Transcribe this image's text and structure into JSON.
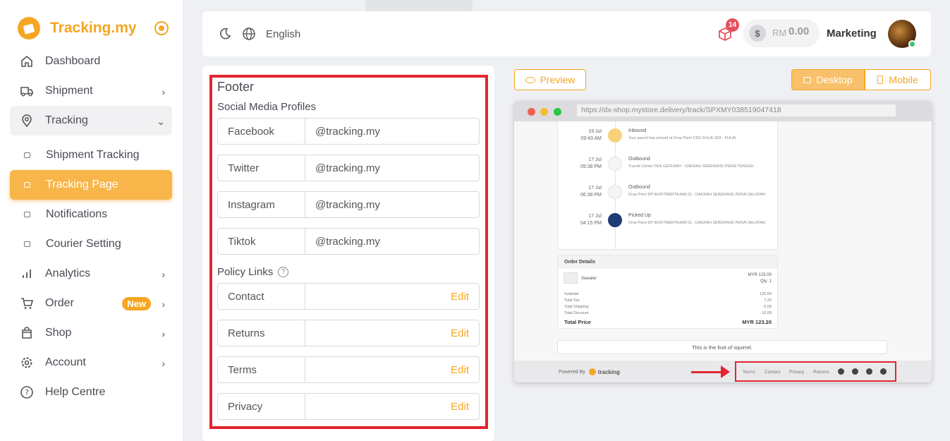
{
  "brand": {
    "name": "Tracking.my",
    "color": "#f5a623"
  },
  "sidebar": {
    "items": [
      {
        "label": "Dashboard",
        "icon": "home-icon"
      },
      {
        "label": "Shipment",
        "icon": "truck-icon",
        "has_chevron": true
      },
      {
        "label": "Tracking",
        "icon": "location-pin-icon",
        "has_chevron": true,
        "expanded": true
      },
      {
        "label": "Analytics",
        "icon": "bar-chart-icon",
        "has_chevron": true
      },
      {
        "label": "Order",
        "icon": "cart-icon",
        "has_chevron": true,
        "badge": "New"
      },
      {
        "label": "Shop",
        "icon": "shopping-bag-icon",
        "has_chevron": true
      },
      {
        "label": "Account",
        "icon": "gear-icon",
        "has_chevron": true
      },
      {
        "label": "Help Centre",
        "icon": "help-circle-icon"
      }
    ],
    "tracking_sub": [
      {
        "label": "Shipment Tracking",
        "active": false
      },
      {
        "label": "Tracking Page",
        "active": true
      },
      {
        "label": "Notifications",
        "active": false
      },
      {
        "label": "Courier Setting",
        "active": false
      }
    ]
  },
  "topbar": {
    "language": "English",
    "notification_count": "14",
    "currency": "RM",
    "balance": "0.00",
    "user_name": "Marketing"
  },
  "footer_settings": {
    "title": "Footer",
    "social_heading": "Social Media Profiles",
    "social": [
      {
        "label": "Facebook",
        "value": "@tracking.my"
      },
      {
        "label": "Twitter",
        "value": "@tracking.my"
      },
      {
        "label": "Instagram",
        "value": "@tracking.my"
      },
      {
        "label": "Tiktok",
        "value": "@tracking.my"
      }
    ],
    "policy_heading": "Policy Links",
    "policies": [
      {
        "label": "Contact",
        "action": "Edit"
      },
      {
        "label": "Returns",
        "action": "Edit"
      },
      {
        "label": "Terms",
        "action": "Edit"
      },
      {
        "label": "Privacy",
        "action": "Edit"
      }
    ]
  },
  "preview": {
    "preview_label": "Preview",
    "desktop_label": "Desktop",
    "mobile_label": "Mobile",
    "url": "https://dx-shop.mystore.delivery/track/SPXMY038519047418",
    "timeline": [
      {
        "date": "19 Jul",
        "time": "09:43 AM",
        "status": "Inbound",
        "desc": "Your parcel has arrived at Drop Point CDC KULAI 303 - KULAI"
      },
      {
        "date": "17 Jul",
        "time": "09:38 PM",
        "status": "Outbound",
        "desc": "Transit Center PEN GATEWAY - DAERAH SEBERANG PERAI TENGAH"
      },
      {
        "date": "17 Jul",
        "time": "06:38 PM",
        "status": "Outbound",
        "desc": "Drop Point DP BUKITMERTAJAM 01 - DAERAH SEBERANG PERAI SELATAN"
      },
      {
        "date": "17 Jul",
        "time": "04:15 PM",
        "status": "Picked Up",
        "desc": "Drop Point DP BUKITMERTAJAM 01 - DAERAH SEBERANG PERAI SELATAN"
      }
    ],
    "order": {
      "title": "Order Details",
      "item": "Sweater",
      "price": "MYR 125.00",
      "qty": "Qty: 1",
      "rows": [
        {
          "label": "Subtotal",
          "value": "120.00"
        },
        {
          "label": "Total Tax",
          "value": "7.20"
        },
        {
          "label": "Total Shipping",
          "value": "6.00"
        },
        {
          "label": "Total Discount",
          "value": "- 10.00"
        }
      ],
      "total_label": "Total Price",
      "total_value": "MYR 123.20"
    },
    "foot_note": "This is the foot of squirrel.",
    "powered_by": "Powered By",
    "powered_brand": "tracking",
    "footer_links": [
      "Terms",
      "Contact",
      "Privacy",
      "Returns"
    ],
    "footer_social_icons": [
      "facebook-icon",
      "twitter-icon",
      "instagram-icon",
      "tiktok-icon"
    ]
  }
}
